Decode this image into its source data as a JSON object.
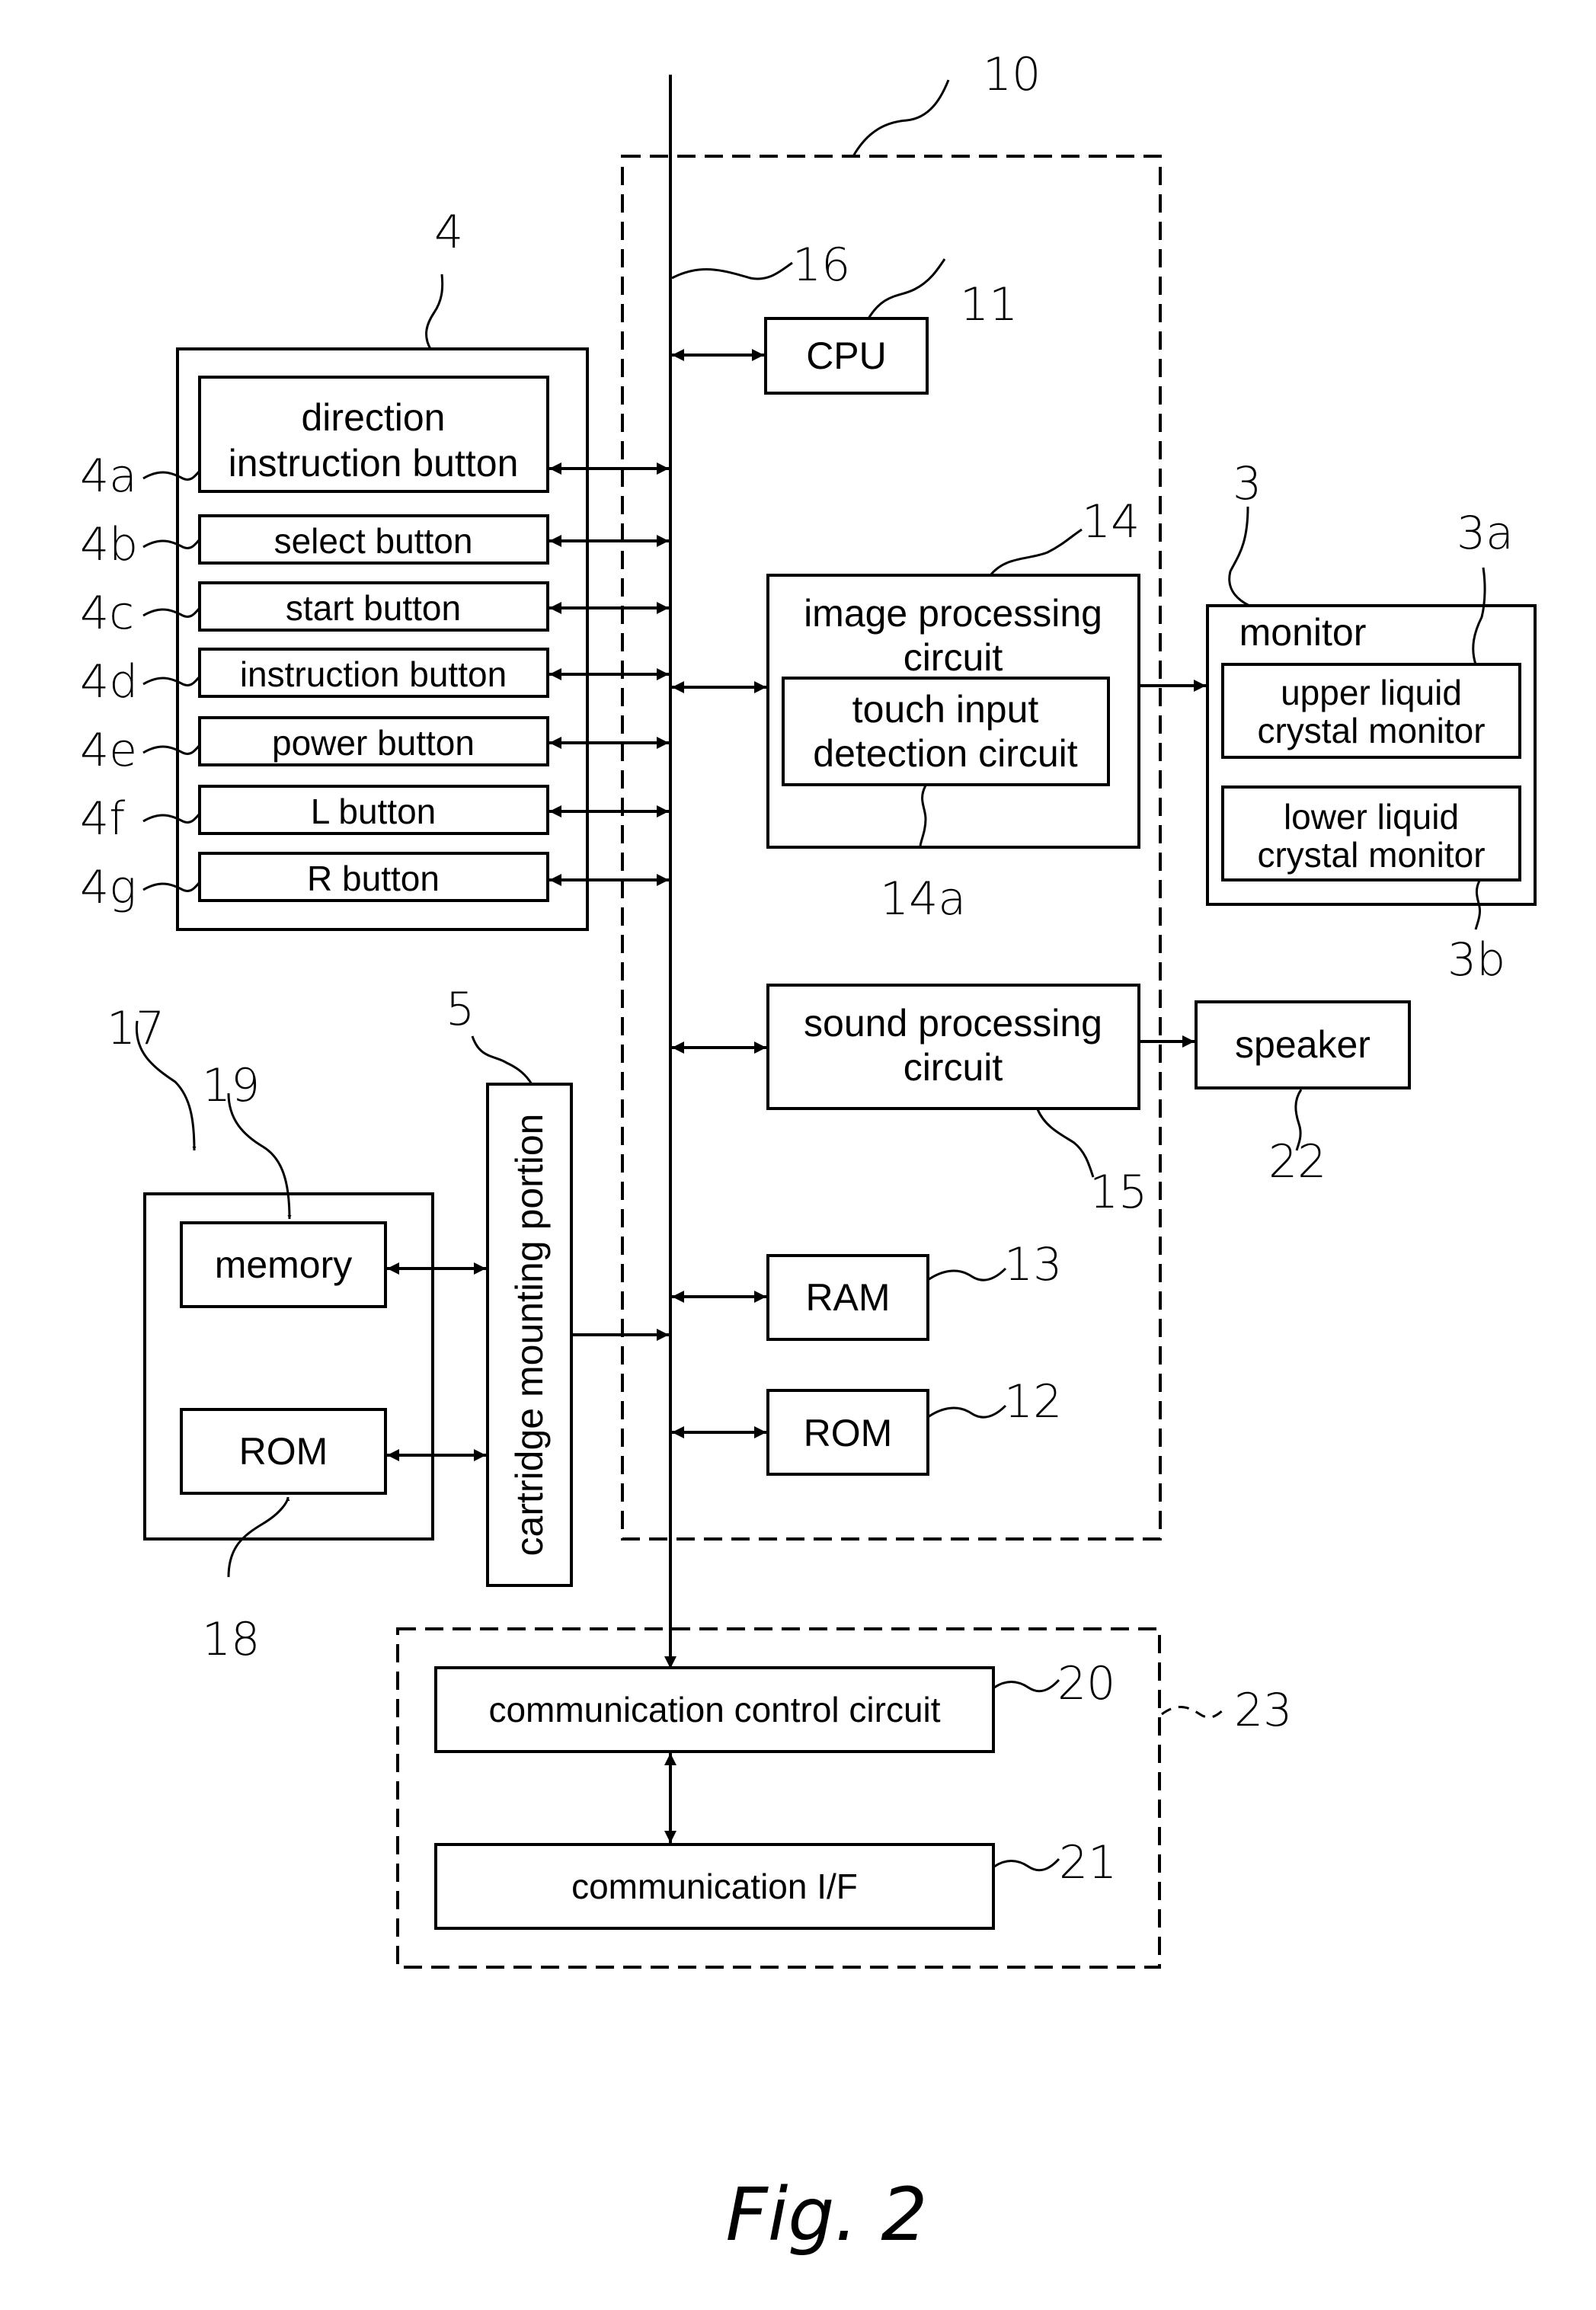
{
  "figure": {
    "caption": "Fig. 2",
    "colors": {
      "ink": "#000000",
      "paper": "#ffffff"
    }
  },
  "blocks": {
    "main_unit": {
      "ref": "10"
    },
    "bus": {
      "ref": "16"
    },
    "cpu": {
      "label": "CPU",
      "ref": "11"
    },
    "image_processing": {
      "label_line1": "image processing",
      "label_line2": "circuit",
      "ref": "14"
    },
    "touch_input": {
      "label_line1": "touch input",
      "label_line2": "detection circuit",
      "ref": "14a"
    },
    "sound_processing": {
      "label_line1": "sound processing",
      "label_line2": "circuit",
      "ref": "15"
    },
    "ram": {
      "label": "RAM",
      "ref": "13"
    },
    "rom_main": {
      "label": "ROM",
      "ref": "12"
    },
    "monitor": {
      "label": "monitor",
      "ref": "3"
    },
    "upper_lcd": {
      "label_line1": "upper liquid",
      "label_line2": "crystal monitor",
      "ref": "3a"
    },
    "lower_lcd": {
      "label_line1": "lower liquid",
      "label_line2": "crystal monitor",
      "ref": "3b"
    },
    "speaker": {
      "label": "speaker",
      "ref": "22"
    },
    "operation_unit": {
      "ref": "4"
    },
    "buttons": [
      {
        "label_line1": "direction",
        "label_line2": "instruction button",
        "ref": "4a"
      },
      {
        "label": "select button",
        "ref": "4b"
      },
      {
        "label": "start button",
        "ref": "4c"
      },
      {
        "label": "instruction button",
        "ref": "4d"
      },
      {
        "label": "power button",
        "ref": "4e"
      },
      {
        "label": "L button",
        "ref": "4f"
      },
      {
        "label": "R button",
        "ref": "4g"
      }
    ],
    "cartridge_mount": {
      "label": "cartridge mounting portion",
      "ref": "5"
    },
    "cartridge": {
      "ref": "17"
    },
    "cart_memory": {
      "label": "memory",
      "ref": "19"
    },
    "cart_rom": {
      "label": "ROM",
      "ref": "18"
    },
    "comm_unit": {
      "ref": "23"
    },
    "comm_control": {
      "label": "communication control circuit",
      "ref": "20"
    },
    "comm_if": {
      "label": "communication I/F",
      "ref": "21"
    }
  }
}
